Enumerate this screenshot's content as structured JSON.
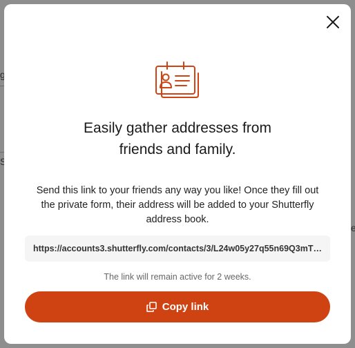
{
  "modal": {
    "title": "Easily gather addresses from friends and family.",
    "description": "Send this link to your friends any way you like! Once they fill out the private form, their address will be added to your Shutterfly address book.",
    "share_link": "https://accounts3.shutterfly.com/contacts/3/L24w05y27q55n69Q3mT…",
    "expiry_note": "The link will remain active for 2 weeks.",
    "copy_button_label": "Copy link",
    "icons": {
      "close": "close-icon",
      "illustration": "contact-card-icon",
      "copy": "copy-icon"
    }
  },
  "colors": {
    "accent": "#cf4313",
    "overlay": "#8e8e8e",
    "link_box_bg": "#f5f5f5"
  }
}
